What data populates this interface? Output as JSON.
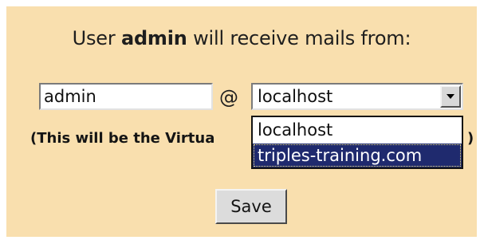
{
  "heading": {
    "prefix": "User ",
    "user_name": "admin",
    "suffix": " will receive mails from:"
  },
  "form": {
    "user_value": "admin",
    "at_symbol": "@",
    "domain_selected": "localhost",
    "note_text": "(This will be the Virtua",
    "note_close": ")",
    "domain_options": [
      "localhost",
      "triples-training.com"
    ],
    "highlighted_option": "triples-training.com",
    "save_label": "Save"
  },
  "icons": {
    "dropdown_arrow": "chevron-down-icon"
  },
  "colors": {
    "panel_background": "#f9dfae",
    "highlight": "#1f2a6e"
  }
}
